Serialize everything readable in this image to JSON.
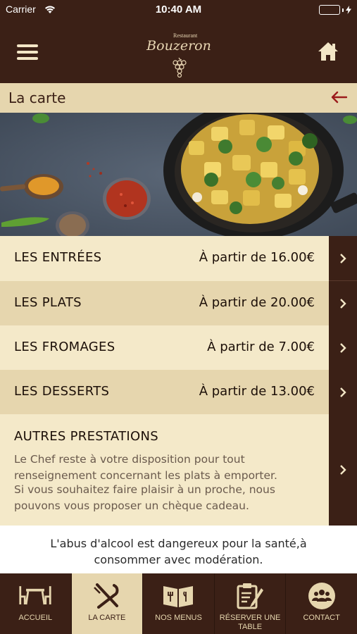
{
  "status_bar": {
    "carrier": "Carrier",
    "time": "10:40 AM"
  },
  "header": {
    "logo_top": "Restaurant",
    "logo_name": "Bouzeron",
    "menu_icon": "hamburger-icon",
    "home_icon": "home-icon"
  },
  "section": {
    "title": "La carte",
    "back_icon": "arrow-left-icon"
  },
  "menu_rows": [
    {
      "name": "LES ENTRÉES",
      "price": "À partir de 16.00€"
    },
    {
      "name": "LES PLATS",
      "price": "À partir de 20.00€"
    },
    {
      "name": "LES FROMAGES",
      "price": "À partir de 7.00€"
    },
    {
      "name": "LES DESSERTS",
      "price": "À partir de 13.00€"
    }
  ],
  "autres": {
    "heading": "AUTRES PRESTATIONS",
    "paragraph1": "Le Chef reste à votre disposition pour tout renseignement concernant les plats à emporter.",
    "paragraph2": "Si vous souhaitez faire plaisir à un proche, nous pouvons vous proposer un chèque cadeau."
  },
  "warning": {
    "line1": "L'abus d'alcool est dangereux pour la santé,à",
    "line2": "consommer avec modération."
  },
  "tabs": [
    {
      "label": "ACCUEIL",
      "icon": "table-chairs-icon",
      "active": false
    },
    {
      "label": "LA CARTE",
      "icon": "fork-knife-icon",
      "active": true
    },
    {
      "label": "NOS MENUS",
      "icon": "menu-book-icon",
      "active": false
    },
    {
      "label": "RÉSERVER UNE TABLE",
      "icon": "clipboard-pen-icon",
      "active": false
    },
    {
      "label": "CONTACT",
      "icon": "contact-group-icon",
      "active": false
    }
  ],
  "colors": {
    "header_bg": "#3b2016",
    "row_light": "#f4e9c9",
    "row_dark": "#e6d6ae",
    "back_arrow": "#9b1b1b"
  }
}
